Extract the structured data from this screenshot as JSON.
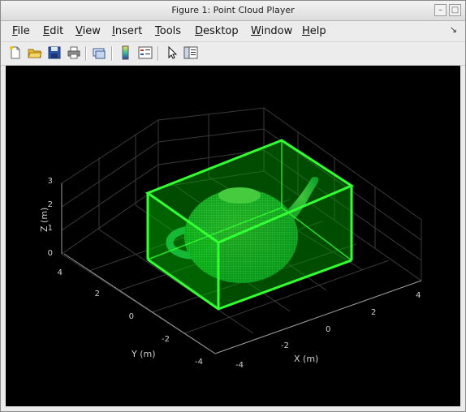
{
  "window": {
    "title": "Figure 1: Point Cloud Player"
  },
  "menubar": {
    "items": [
      {
        "label": "File",
        "mnemonic": "F",
        "rest": "ile"
      },
      {
        "label": "Edit",
        "mnemonic": "E",
        "rest": "dit"
      },
      {
        "label": "View",
        "mnemonic": "V",
        "rest": "iew"
      },
      {
        "label": "Insert",
        "mnemonic": "I",
        "rest": "nsert"
      },
      {
        "label": "Tools",
        "mnemonic": "T",
        "rest": "ools"
      },
      {
        "label": "Desktop",
        "mnemonic": "D",
        "rest": "esktop"
      },
      {
        "label": "Window",
        "mnemonic": "W",
        "rest": "indow"
      },
      {
        "label": "Help",
        "mnemonic": "H",
        "rest": "elp"
      }
    ],
    "dock_glyph": "↘"
  },
  "toolbar": {
    "buttons": [
      "new-figure-icon",
      "open-file-icon",
      "save-icon",
      "print-icon",
      "link-plot-icon",
      "colorbar-icon",
      "legend-icon",
      "edit-plot-cursor-icon",
      "property-inspector-icon"
    ]
  },
  "plot": {
    "zlabel": "Z (m)",
    "ylabel": "Y (m)",
    "xlabel": "X (m)",
    "z_ticks": [
      "3",
      "2",
      "1",
      "0"
    ],
    "y_ticks": [
      "4",
      "2",
      "0",
      "-2",
      "-4"
    ],
    "x_ticks": [
      "-4",
      "-2",
      "0",
      "2",
      "4"
    ],
    "background": "#000000",
    "box_color": "#33ff33",
    "box_fill": "#00a800",
    "cloud_color": "#44dd66"
  }
}
